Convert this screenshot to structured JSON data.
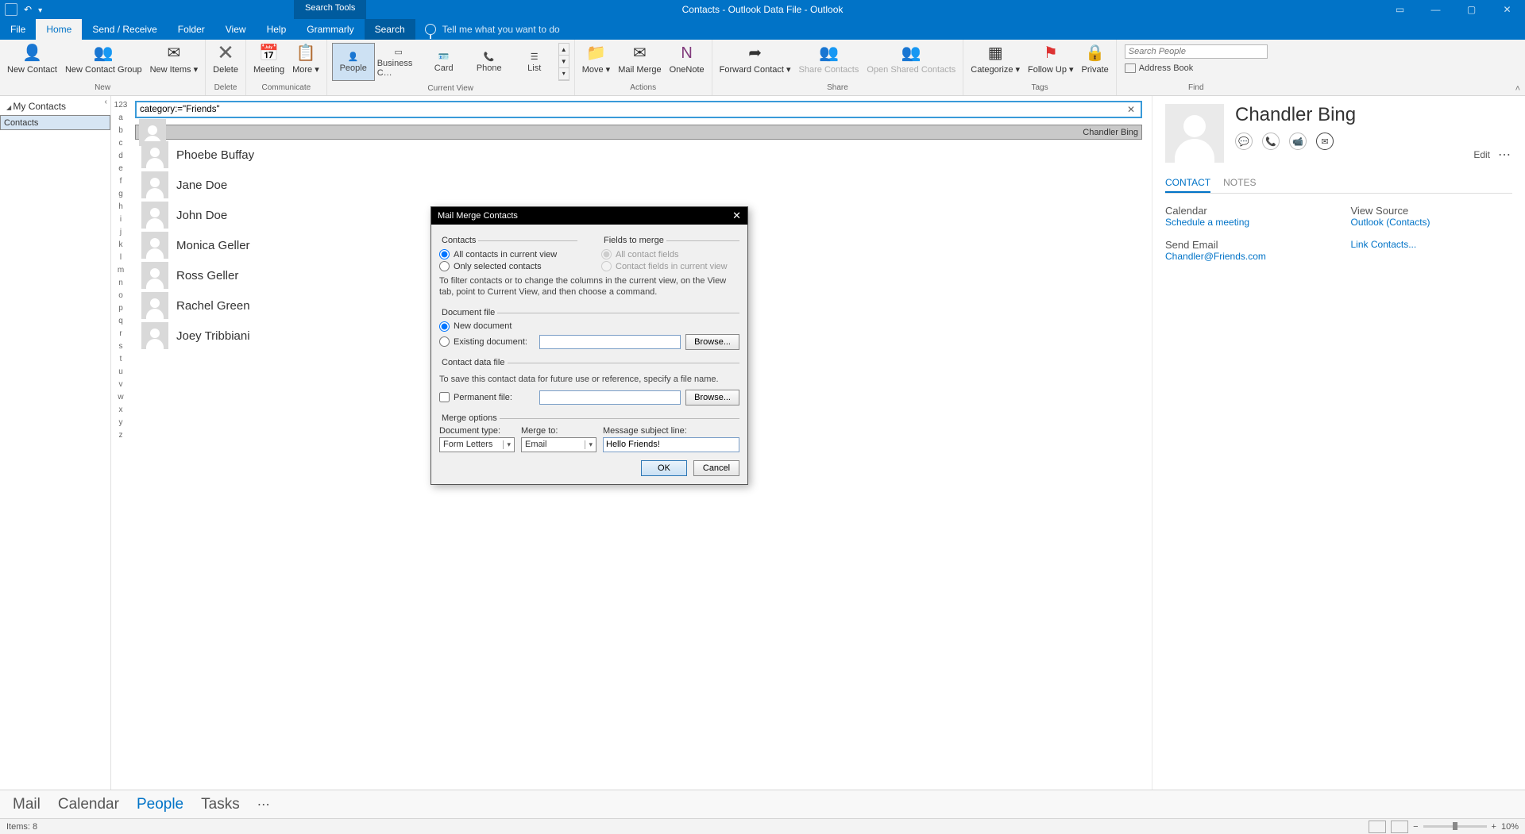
{
  "title": "Contacts - Outlook Data File  -  Outlook",
  "searchToolsLabel": "Search Tools",
  "menu": {
    "file": "File",
    "home": "Home",
    "sendreceive": "Send / Receive",
    "folder": "Folder",
    "view": "View",
    "help": "Help",
    "grammarly": "Grammarly",
    "search": "Search",
    "tellme": "Tell me what you want to do"
  },
  "ribbon": {
    "new": {
      "contact": "New Contact",
      "group": "New Contact Group",
      "items": "New Items ▾",
      "label": "New"
    },
    "delete": {
      "delete": "Delete",
      "label": "Delete"
    },
    "communicate": {
      "meeting": "Meeting",
      "more": "More ▾",
      "label": "Communicate"
    },
    "currentview": {
      "people": "People",
      "business": "Business C…",
      "card": "Card",
      "phone": "Phone",
      "list": "List",
      "label": "Current View"
    },
    "actions": {
      "move": "Move ▾",
      "mailmerge": "Mail Merge",
      "onenote": "OneNote",
      "label": "Actions"
    },
    "share": {
      "forward": "Forward Contact ▾",
      "sharecontacts": "Share Contacts",
      "openshared": "Open Shared Contacts",
      "label": "Share"
    },
    "tags": {
      "categorize": "Categorize ▾",
      "followup": "Follow Up ▾",
      "private": "Private",
      "label": "Tags"
    },
    "find": {
      "searchPlaceholder": "Search People",
      "addressbook": "Address Book",
      "label": "Find"
    }
  },
  "nav": {
    "header": "My Contacts",
    "item": "Contacts"
  },
  "alpha": [
    "123",
    "a",
    "b",
    "c",
    "d",
    "e",
    "f",
    "g",
    "h",
    "i",
    "j",
    "k",
    "l",
    "m",
    "n",
    "o",
    "p",
    "q",
    "r",
    "s",
    "t",
    "u",
    "v",
    "w",
    "x",
    "y",
    "z"
  ],
  "searchQuery": "category:=\"Friends\"",
  "contacts": [
    "Chandler Bing",
    "Phoebe Buffay",
    "Jane Doe",
    "John Doe",
    "Monica Geller",
    "Ross Geller",
    "Rachel Green",
    "Joey Tribbiani"
  ],
  "detail": {
    "name": "Chandler Bing",
    "edit": "Edit",
    "tabContact": "CONTACT",
    "tabNotes": "NOTES",
    "calendar": "Calendar",
    "schedule": "Schedule a meeting",
    "sendemail": "Send Email",
    "email": "Chandler@Friends.com",
    "viewsource": "View Source",
    "outlookcontacts": "Outlook (Contacts)",
    "linkcontacts": "Link Contacts..."
  },
  "switcher": {
    "mail": "Mail",
    "calendar": "Calendar",
    "people": "People",
    "tasks": "Tasks"
  },
  "status": {
    "items": "Items: 8",
    "zoom": "10%"
  },
  "dialog": {
    "title": "Mail Merge Contacts",
    "contacts": "Contacts",
    "fields": "Fields to merge",
    "allCurrent": "All contacts in current view",
    "onlySelected": "Only selected contacts",
    "allFields": "All contact fields",
    "fieldsInView": "Contact fields in current view",
    "filterHint": "To filter contacts or to change the columns in the current view, on the View tab, point to Current View, and then choose a command.",
    "docfile": "Document file",
    "newdoc": "New document",
    "existing": "Existing document:",
    "browse": "Browse...",
    "contactdata": "Contact data file",
    "saveHint": "To save this contact data for future use or reference, specify a file name.",
    "permanent": "Permanent file:",
    "mergeopts": "Merge options",
    "doctype": "Document type:",
    "doctypeVal": "Form Letters",
    "mergeto": "Merge to:",
    "mergetoVal": "Email",
    "subjline": "Message subject line:",
    "subjVal": "Hello Friends!",
    "ok": "OK",
    "cancel": "Cancel"
  }
}
